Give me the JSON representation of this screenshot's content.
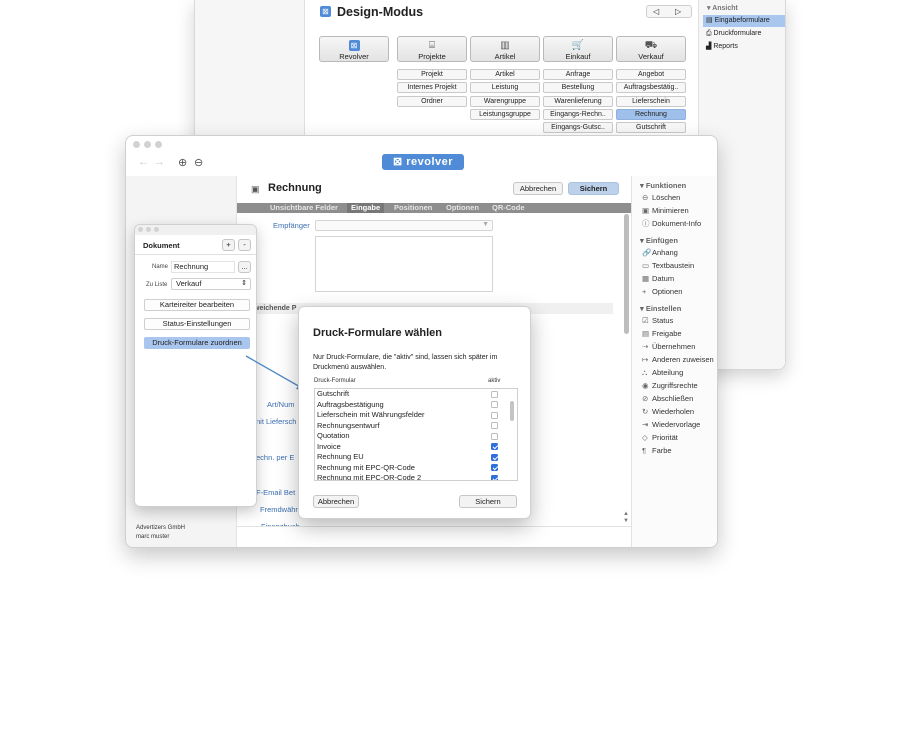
{
  "design": {
    "title": "Design-Modus",
    "nav_prev": "◁",
    "nav_next": "▷",
    "categories": [
      {
        "label": "Revolver",
        "icon": "revolver-logo-icon"
      },
      {
        "label": "Projekte",
        "icon": "projects-icon"
      },
      {
        "label": "Artikel",
        "icon": "barcode-icon"
      },
      {
        "label": "Einkauf",
        "icon": "cart-icon"
      },
      {
        "label": "Verkauf",
        "icon": "sales-icon"
      }
    ],
    "sub_projekte": [
      "Projekt",
      "Internes Projekt",
      "Ordner"
    ],
    "sub_artikel": [
      "Artikel",
      "Leistung",
      "Warengruppe",
      "Leistungsgruppe"
    ],
    "sub_einkauf": [
      "Anfrage",
      "Bestellung",
      "Warenlieferung",
      "Eingangs-Rechn..",
      "Eingangs-Gutsc.."
    ],
    "sub_verkauf": [
      "Angebot",
      "Auftragsbestätig..",
      "Lieferschein",
      "Rechnung",
      "Gutschrift"
    ],
    "selected_sub": "Rechnung",
    "ansicht": {
      "header": "▾ Ansicht",
      "items": [
        "Eingabeformulare",
        "Druckformulare",
        "Reports"
      ],
      "selected": "Eingabeformulare"
    }
  },
  "main": {
    "logo": "⊠ revolver",
    "nav_back": "←",
    "nav_forward": "→",
    "zoom_in": "⊕",
    "zoom_out": "⊖",
    "doc_title": "Rechnung",
    "cancel": "Abbrechen",
    "save": "Sichern",
    "tabs": [
      "Unsichtbare Felder",
      "Eingabe",
      "Positionen",
      "Optionen",
      "QR-Code"
    ],
    "active_tab": "Eingabe",
    "empfaenger_label": "Empfänger",
    "section_label": "weichende P",
    "cut_labels": [
      "Art/Num",
      "nit Liefersch",
      "echn. per E",
      "F-Email Bet",
      "Fremdwähr",
      "Finanzbuch"
    ],
    "footer_company": "Advertizers GmbH",
    "footer_user": "marc muster"
  },
  "sidebar": {
    "funktionen_header": "▾ Funktionen",
    "funktionen": [
      {
        "label": "Löschen",
        "icon": "⊖"
      },
      {
        "label": "Minimieren",
        "icon": "▣"
      },
      {
        "label": "Dokument-Info",
        "icon": "ⓘ"
      }
    ],
    "einfuegen_header": "▾ Einfügen",
    "einfuegen": [
      {
        "label": "Anhang",
        "icon": "🔗"
      },
      {
        "label": "Textbaustein",
        "icon": "▭"
      },
      {
        "label": "Datum",
        "icon": "▦"
      },
      {
        "label": "Optionen",
        "icon": "+"
      }
    ],
    "einstellen_header": "▾ Einstellen",
    "einstellen": [
      {
        "label": "Status",
        "icon": "☑"
      },
      {
        "label": "Freigabe",
        "icon": "▤"
      },
      {
        "label": "Übernehmen",
        "icon": "⇢"
      },
      {
        "label": "Anderen zuweisen",
        "icon": "↦"
      },
      {
        "label": "Abteilung",
        "icon": "⛬"
      },
      {
        "label": "Zugriffsrechte",
        "icon": "◉"
      },
      {
        "label": "Abschließen",
        "icon": "⊘"
      },
      {
        "label": "Wiederholen",
        "icon": "↻"
      },
      {
        "label": "Wiedervorlage",
        "icon": "⇥"
      },
      {
        "label": "Priorität",
        "icon": "◇"
      },
      {
        "label": "Farbe",
        "icon": "¶"
      }
    ]
  },
  "doc_palette": {
    "title": "Dokument",
    "add": "+",
    "remove": "-",
    "name_label": "Name",
    "name_value": "Rechnung",
    "more": "...",
    "liste_label": "Zu Liste",
    "liste_value": "Verkauf",
    "buttons": [
      "Karteireiter bearbeiten",
      "Status-Einstellungen",
      "Druck-Formulare zuordnen"
    ],
    "selected_button": "Druck-Formulare zuordnen"
  },
  "dialog": {
    "title": "Druck-Formulare wählen",
    "description": "Nur Druck-Formulare, die \"aktiv\" sind, lassen sich später im Druckmenü auswählen.",
    "col_form": "Druck-Formular",
    "col_active": "aktiv",
    "forms": [
      {
        "name": "Gutschrift",
        "active": false
      },
      {
        "name": "Auftragsbestätigung",
        "active": false
      },
      {
        "name": "Lieferschein mit Währungsfelder",
        "active": false
      },
      {
        "name": "Rechnungsentwurf",
        "active": false
      },
      {
        "name": "Quotation",
        "active": false
      },
      {
        "name": "Invoice",
        "active": true
      },
      {
        "name": "Rechnung EU",
        "active": true
      },
      {
        "name": "Rechnung mit EPC-QR-Code",
        "active": true
      },
      {
        "name": "Rechnung mit EPC-QR-Code 2",
        "active": true
      }
    ],
    "cancel": "Abbrechen",
    "save": "Sichern"
  },
  "colors": {
    "accent": "#4f8bd6",
    "selection": "#9fc0ea",
    "checkbox_on": "#2f6fdc",
    "arrow": "#4a86c5"
  }
}
